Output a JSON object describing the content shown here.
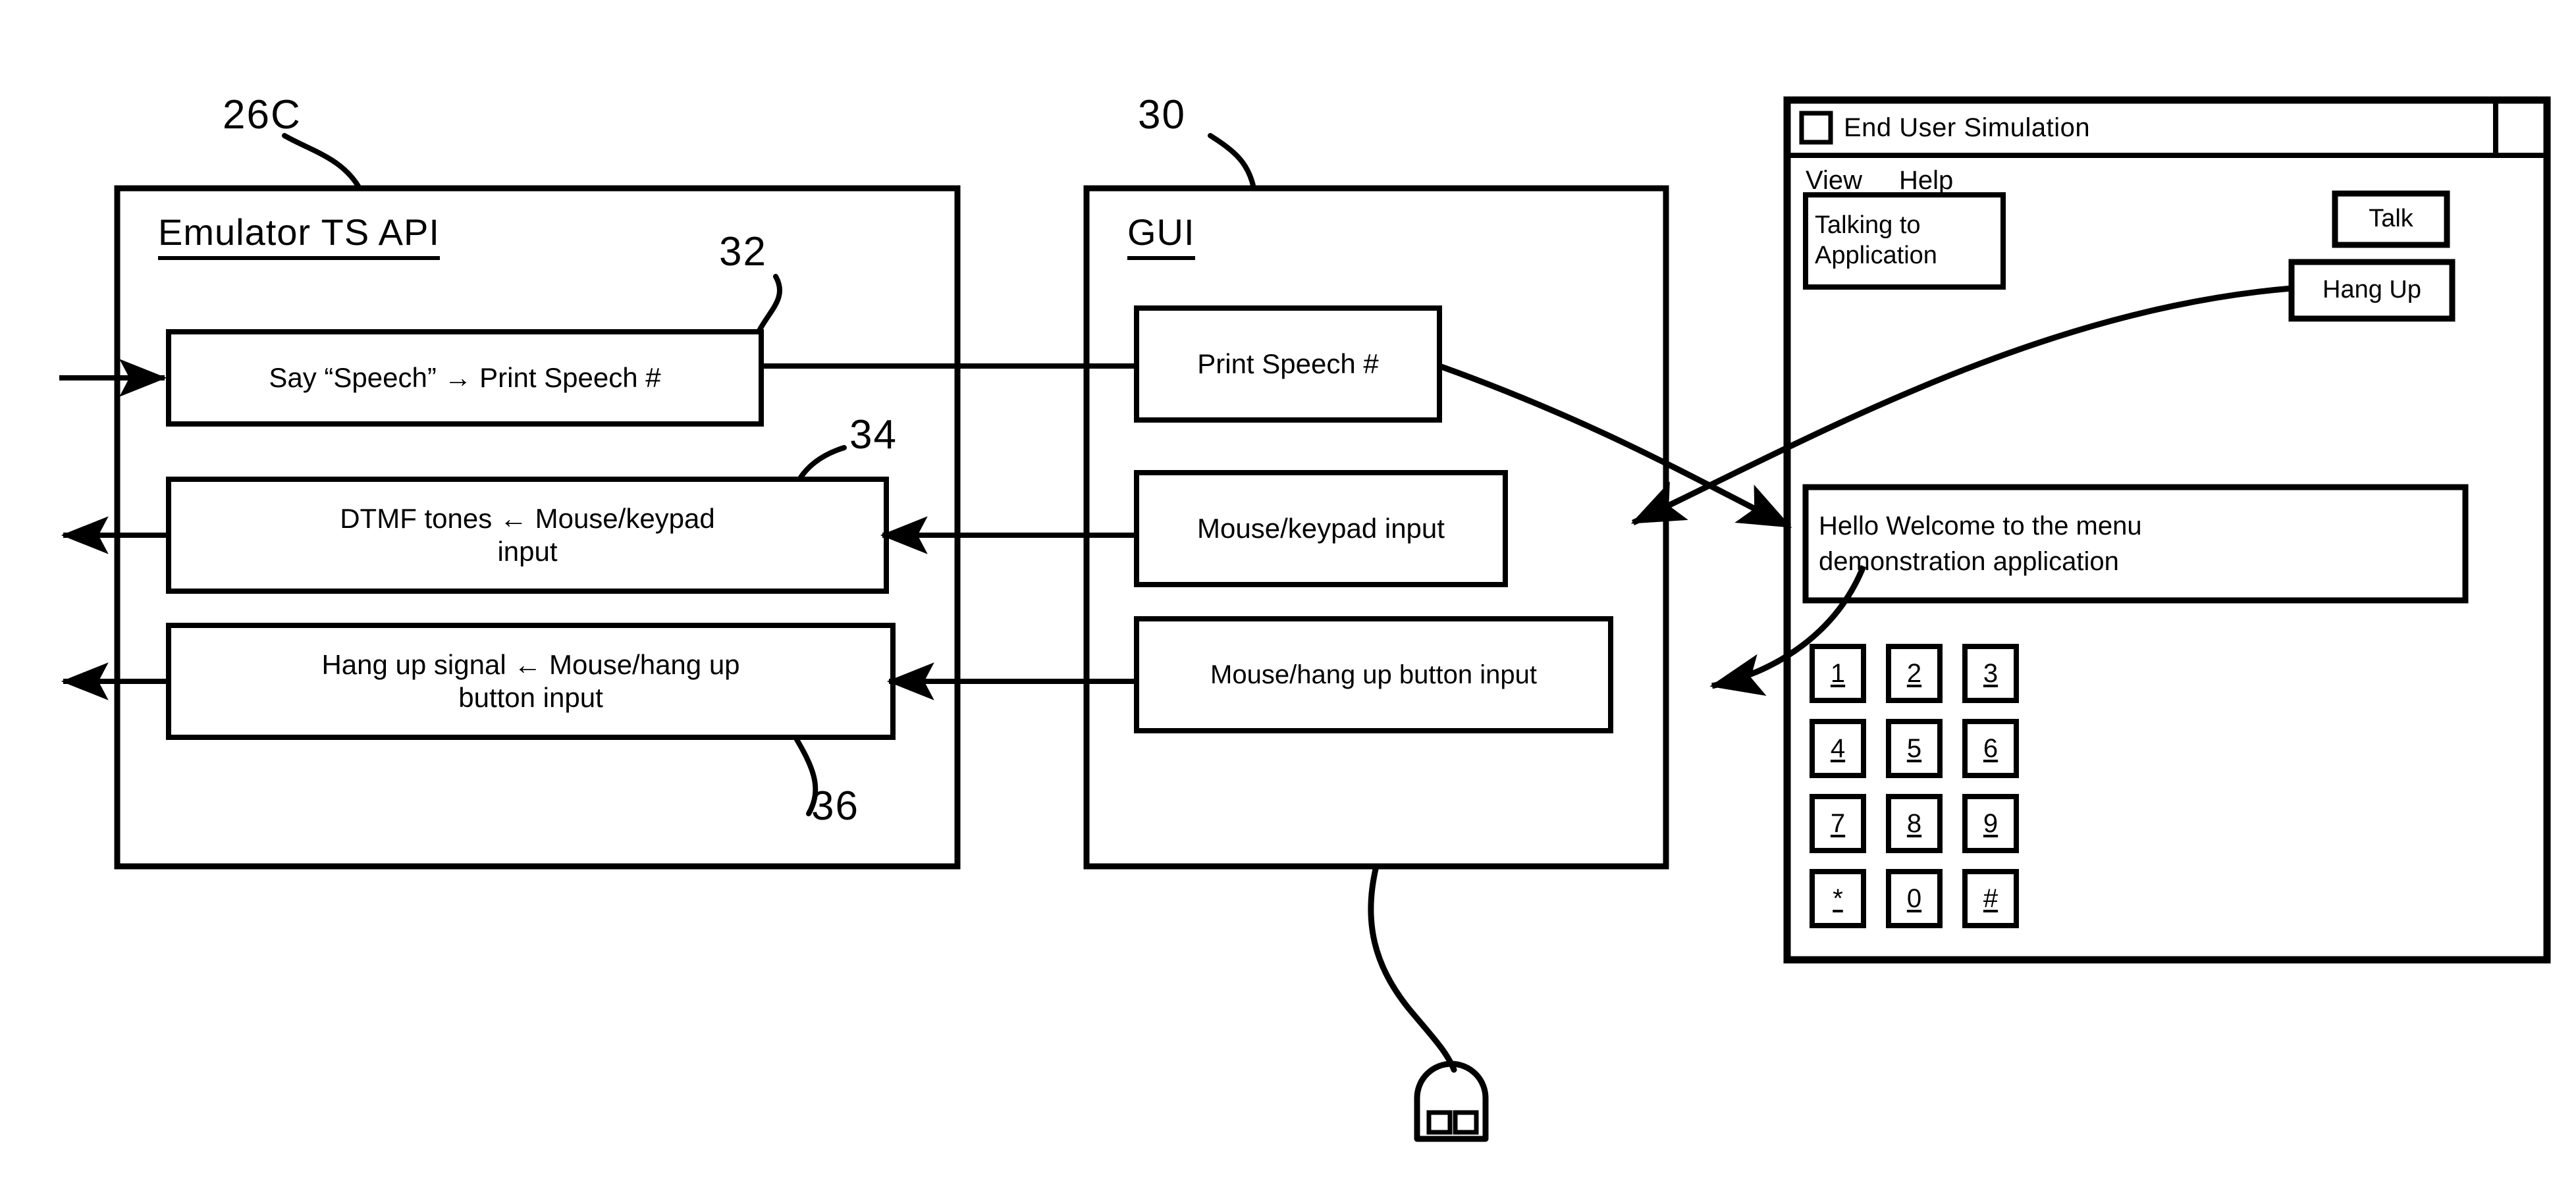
{
  "figure": {
    "type": "patent-block-diagram",
    "reference_numerals": {
      "emulator_panel": "26C",
      "gui_panel": "30",
      "speech_box": "32",
      "dtmf_box": "34",
      "hangup_box": "36"
    }
  },
  "emulator_panel": {
    "title": "Emulator TS API",
    "boxes": [
      {
        "id": "speech",
        "text": "Say “Speech” → Print Speech #",
        "ref": "32"
      },
      {
        "id": "dtmf",
        "line1": "DTMF tones ← Mouse/keypad",
        "line2": "input",
        "ref": "34"
      },
      {
        "id": "hangup",
        "line1": "Hang up signal ← Mouse/hang up",
        "line2": "button input",
        "ref": "36"
      }
    ]
  },
  "gui_panel": {
    "title": "GUI",
    "ref": "30",
    "boxes": [
      {
        "id": "print-speech",
        "text": "Print Speech #"
      },
      {
        "id": "mouse-keypad",
        "text": "Mouse/keypad input"
      },
      {
        "id": "mouse-hangup",
        "text": "Mouse/hang up button input"
      }
    ],
    "peripheral": {
      "name": "mouse-icon",
      "buttons": 2
    }
  },
  "simulation_window": {
    "title": "End User Simulation",
    "system_menu_icon": "window-square-icon",
    "titlebar_control_icon": "window-control-box-icon",
    "menubar": [
      {
        "label": "View",
        "accel": "V"
      },
      {
        "label": "Help",
        "accel": "H"
      }
    ],
    "status_box": {
      "line1": "Talking to",
      "line2": "Application"
    },
    "buttons": [
      {
        "id": "talk",
        "label": "Talk"
      },
      {
        "id": "hang-up",
        "label": "Hang Up"
      }
    ],
    "message_box": {
      "line1": "Hello Welcome to the menu",
      "line2": "demonstration application"
    },
    "keypad": {
      "rows": [
        [
          "1",
          "2",
          "3"
        ],
        [
          "4",
          "5",
          "6"
        ],
        [
          "7",
          "8",
          "9"
        ],
        [
          "*",
          "0",
          "#"
        ]
      ]
    }
  },
  "colors": {
    "ink": "#000000",
    "paper": "#ffffff"
  }
}
